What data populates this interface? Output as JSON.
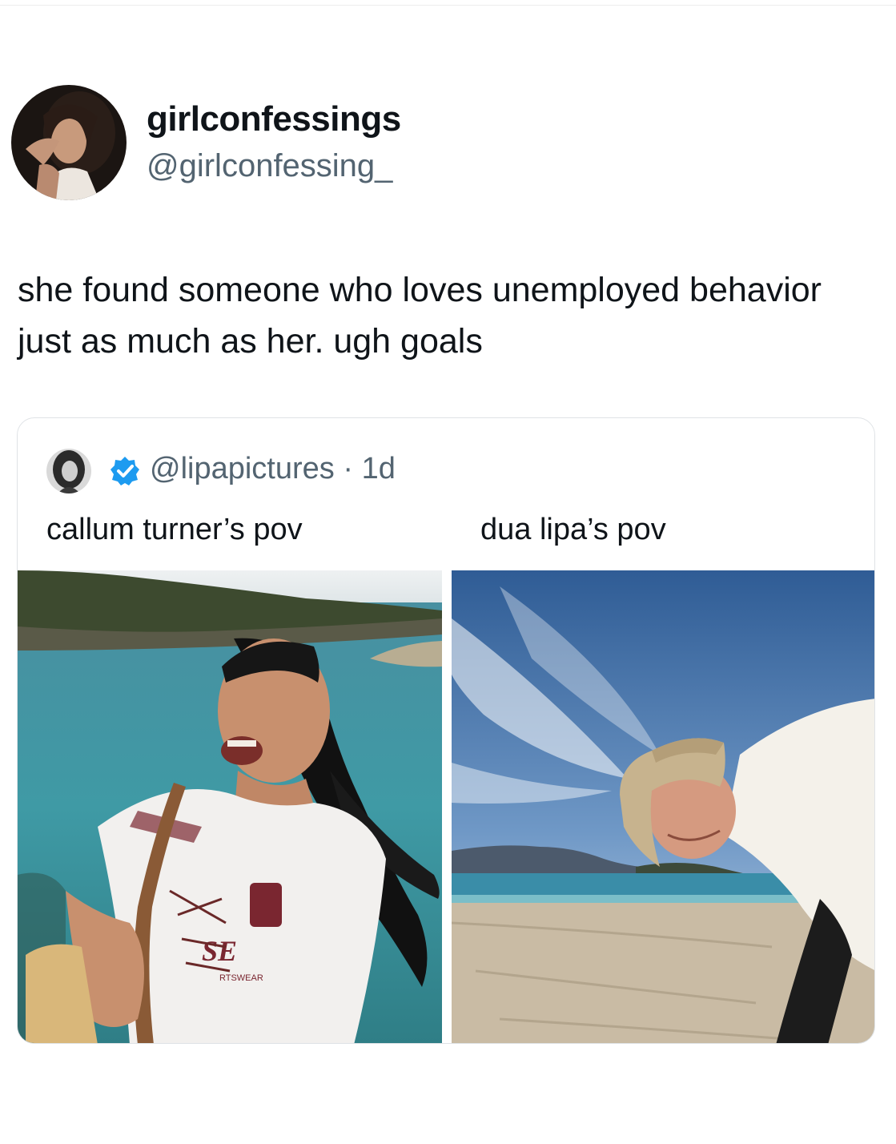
{
  "post": {
    "display_name": "girlconfessings",
    "handle": "@girlconfessing_",
    "text": "she found someone who loves unemployed behavior just as much as her. ugh goals"
  },
  "quoted_post": {
    "handle": "@lipapictures",
    "separator": "·",
    "age": "1d",
    "verified_color": "#1d9bf0",
    "left_caption": "callum turner’s pov",
    "right_caption": "dua lipa’s pov",
    "jersey_text": "SE",
    "jersey_subtext": "RTSWEAR"
  },
  "icons": {
    "verified": "verified-badge-icon"
  }
}
